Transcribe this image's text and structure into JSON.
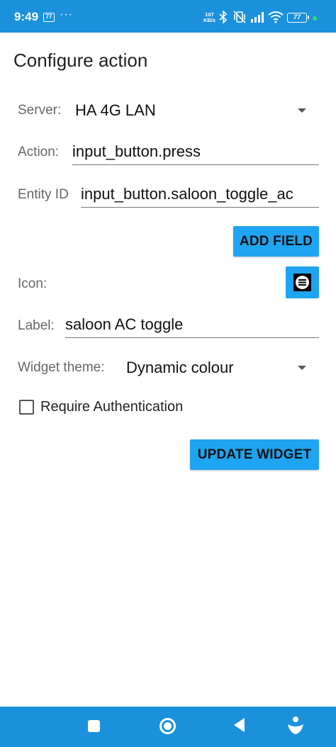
{
  "status_bar": {
    "time": "9:49",
    "badge": "77",
    "dots": "···",
    "speed_value": "107",
    "speed_unit": "KB/s",
    "battery": "77"
  },
  "page": {
    "title": "Configure action"
  },
  "form": {
    "server": {
      "label": "Server:",
      "value": "HA 4G LAN"
    },
    "action": {
      "label": "Action:",
      "value": "input_button.press"
    },
    "entity": {
      "label": "Entity ID",
      "value": "input_button.saloon_toggle_ac"
    },
    "add_field_label": "ADD FIELD",
    "icon": {
      "label": "Icon:",
      "icon_name": "format-align-justify-icon"
    },
    "widget_label": {
      "label": "Label:",
      "value": "saloon AC toggle"
    },
    "theme": {
      "label": "Widget theme:",
      "value": "Dynamic colour"
    },
    "require_auth": {
      "label": "Require Authentication",
      "checked": false
    },
    "update_label": "UPDATE WIDGET"
  },
  "colors": {
    "bar": "#1b91dc",
    "accent": "#1ea4f0"
  }
}
